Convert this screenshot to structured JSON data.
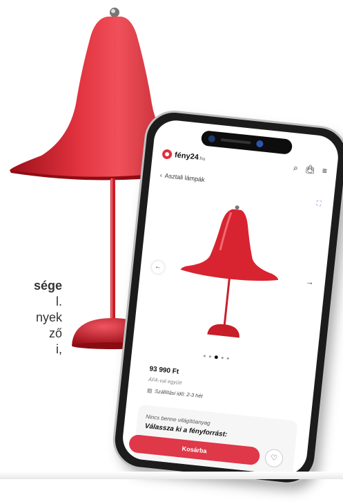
{
  "side_text": {
    "line1": "sége",
    "line2": "l.",
    "line3": "nyek",
    "line4": "ző",
    "line5": "i,"
  },
  "app": {
    "logo_text": "fény24",
    "logo_domain": ".hu",
    "breadcrumb": "Asztali lámpák",
    "price": "93 990 Ft",
    "vat_note": "ÁFA-val együtt",
    "shipping": "Szállítási idő: 2-3 hét",
    "no_bulb": "Nincs benne világítóanyag",
    "choose_light": "Válassza ki a fényforrást:",
    "cart_button": "Kosárba",
    "carousel": {
      "count": 5,
      "active_index": 2
    }
  },
  "icons": {
    "logo": "logo-mark-icon",
    "search": "search-icon",
    "bag": "shopping-bag-icon",
    "menu": "menu-icon",
    "back": "chevron-left-icon",
    "zoom": "zoom-icon",
    "prev": "arrow-left-icon",
    "next": "arrow-right-icon",
    "truck": "truck-icon",
    "wishlist": "heart-icon"
  },
  "colors": {
    "brand_red": "#df3849",
    "lamp_red": "#d82430",
    "phone_frame": "#1c1c1c"
  }
}
